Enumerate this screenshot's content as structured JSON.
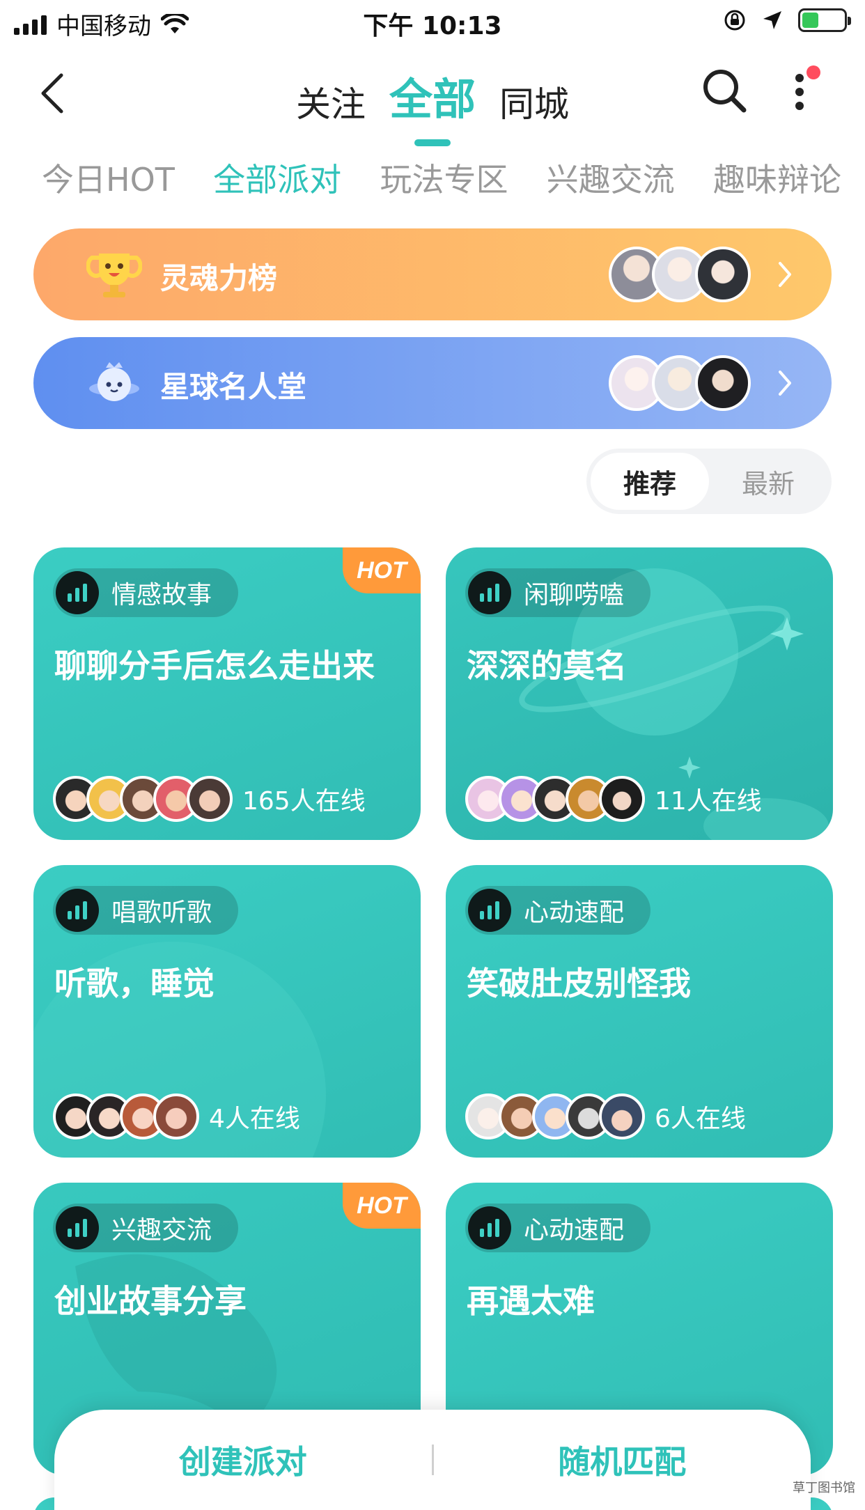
{
  "status_bar": {
    "carrier": "中国移动",
    "time": "下午 10:13"
  },
  "top_nav": {
    "tabs": [
      {
        "label": "关注"
      },
      {
        "label": "全部"
      },
      {
        "label": "同城"
      }
    ],
    "active_tab": "全部"
  },
  "category_tabs": [
    {
      "label": "今日HOT"
    },
    {
      "label": "全部派对"
    },
    {
      "label": "玩法专区"
    },
    {
      "label": "兴趣交流"
    },
    {
      "label": "趣味辩论"
    }
  ],
  "active_category": "全部派对",
  "banners": [
    {
      "label": "灵魂力榜",
      "icon": "trophy-icon"
    },
    {
      "label": "星球名人堂",
      "icon": "planet-mascot-icon"
    }
  ],
  "sort": {
    "options": [
      {
        "label": "推荐"
      },
      {
        "label": "最新"
      }
    ],
    "active": "推荐"
  },
  "rooms": [
    {
      "tag": "情感故事",
      "title": "聊聊分手后怎么走出来",
      "online": "165人在线",
      "hot": true,
      "hot_label": "HOT",
      "member_count": 5
    },
    {
      "tag": "闲聊唠嗑",
      "title": "深深的莫名",
      "online": "11人在线",
      "hot": false,
      "member_count": 5
    },
    {
      "tag": "唱歌听歌",
      "title": "听歌，睡觉",
      "online": "4人在线",
      "hot": false,
      "member_count": 4
    },
    {
      "tag": "心动速配",
      "title": "笑破肚皮别怪我",
      "online": "6人在线",
      "hot": false,
      "member_count": 5
    },
    {
      "tag": "兴趣交流",
      "title": "创业故事分享",
      "online": "",
      "hot": true,
      "hot_label": "HOT",
      "member_count": 0
    },
    {
      "tag": "心动速配",
      "title": "再遇太难",
      "online": "",
      "hot": false,
      "member_count": 0
    }
  ],
  "bottom_bar": {
    "create_label": "创建派对",
    "match_label": "随机匹配"
  },
  "watermark": "草丁图书馆",
  "colors": {
    "accent": "#2fc2b9",
    "card": "#3bcdc3",
    "hot": "#ff9a3a",
    "banner_rank_start": "#fda86a",
    "banner_rank_end": "#fec86b",
    "banner_fame_start": "#5f8ff0",
    "banner_fame_end": "#96b6f5"
  }
}
